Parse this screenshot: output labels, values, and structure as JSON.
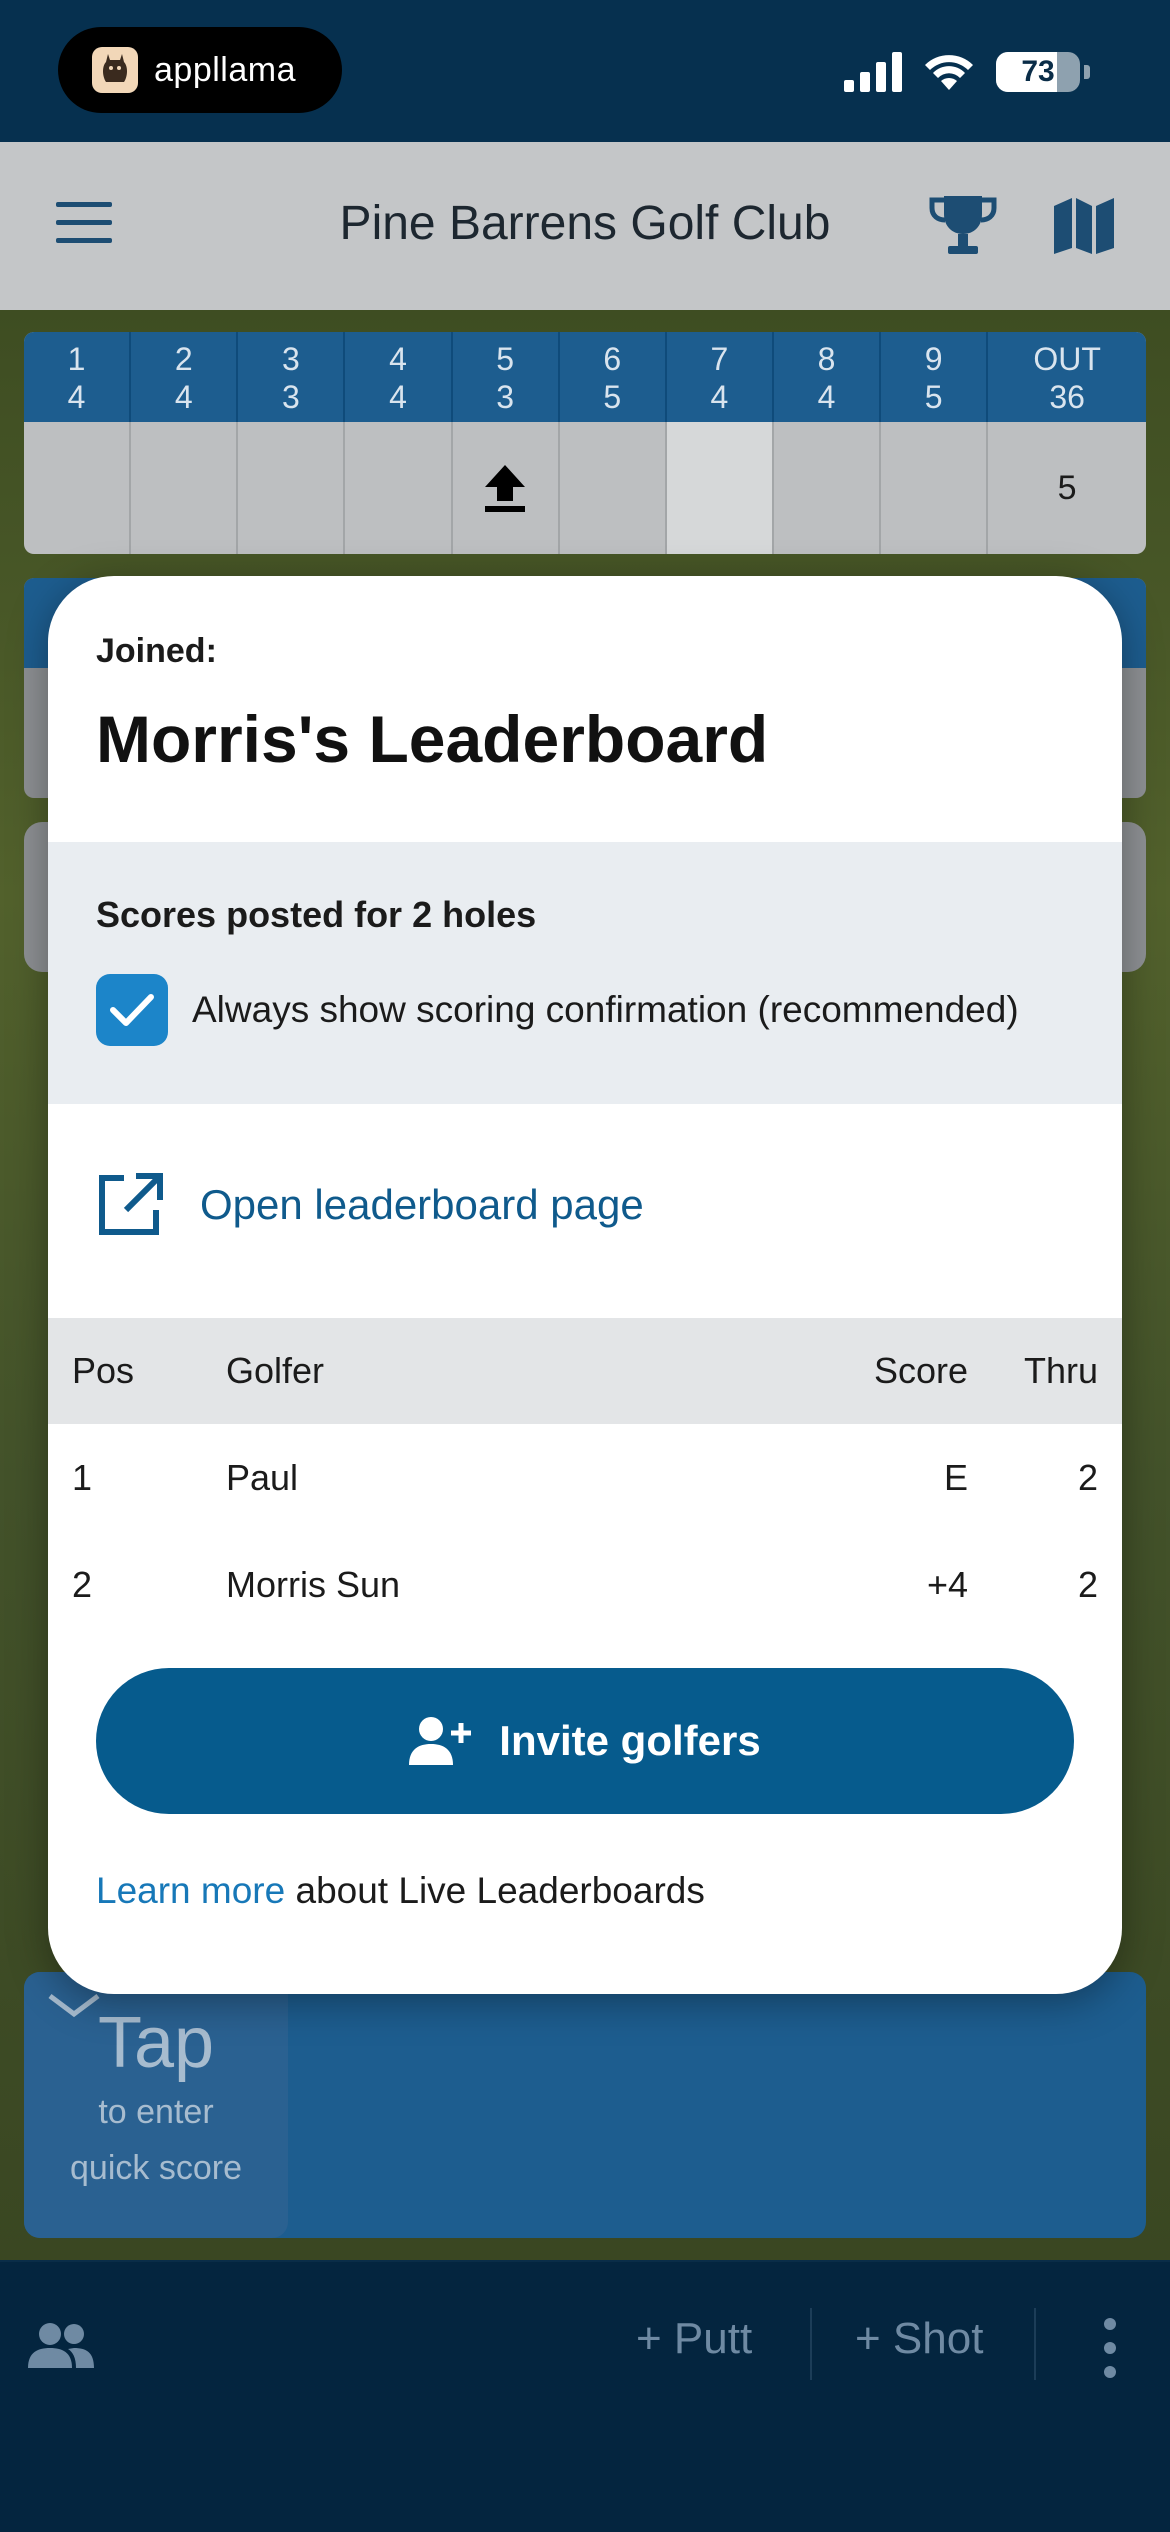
{
  "status_bar": {
    "brand_name": "appllama",
    "battery": "73"
  },
  "header": {
    "title": "Pine Barrens Golf Club",
    "icons": [
      "menu-icon",
      "trophy-icon",
      "map-icon"
    ]
  },
  "scorecard": {
    "holes": [
      {
        "hole": "1",
        "par": "4",
        "score": ""
      },
      {
        "hole": "2",
        "par": "4",
        "score": ""
      },
      {
        "hole": "3",
        "par": "3",
        "score": ""
      },
      {
        "hole": "4",
        "par": "4",
        "score": ""
      },
      {
        "hole": "5",
        "par": "3",
        "score": ""
      },
      {
        "hole": "6",
        "par": "5",
        "score": ""
      },
      {
        "hole": "7",
        "par": "4",
        "score": ""
      },
      {
        "hole": "8",
        "par": "4",
        "score": ""
      },
      {
        "hole": "9",
        "par": "5",
        "score": ""
      }
    ],
    "out_label": "OUT",
    "out_par": "36",
    "out_score": "5",
    "upload_icon": "upload-icon"
  },
  "modal": {
    "joined_label": "Joined:",
    "title": "Morris's Leaderboard",
    "posted_text": "Scores posted for 2 holes",
    "confirm_label": "Always show scoring confirmation (recommended)",
    "confirm_checked": true,
    "open_link": "Open leaderboard page",
    "table": {
      "headers": {
        "pos": "Pos",
        "golfer": "Golfer",
        "score": "Score",
        "thru": "Thru"
      },
      "rows": [
        {
          "pos": "1",
          "golfer": "Paul",
          "score": "E",
          "thru": "2"
        },
        {
          "pos": "2",
          "golfer": "Morris Sun",
          "score": "+4",
          "thru": "2"
        }
      ]
    },
    "invite_button": "Invite golfers",
    "learn_more_link": "Learn more",
    "learn_more_rest": " about Live Leaderboards"
  },
  "quick_score": {
    "big": "Tap",
    "line1": "to enter",
    "line2": "quick score"
  },
  "bottom_bar": {
    "putt": "+ Putt",
    "shot": "+ Shot"
  },
  "colors": {
    "primary": "#065b8d",
    "link": "#1778b8",
    "status_bar": "#06304f",
    "checkbox": "#1c85c9"
  }
}
